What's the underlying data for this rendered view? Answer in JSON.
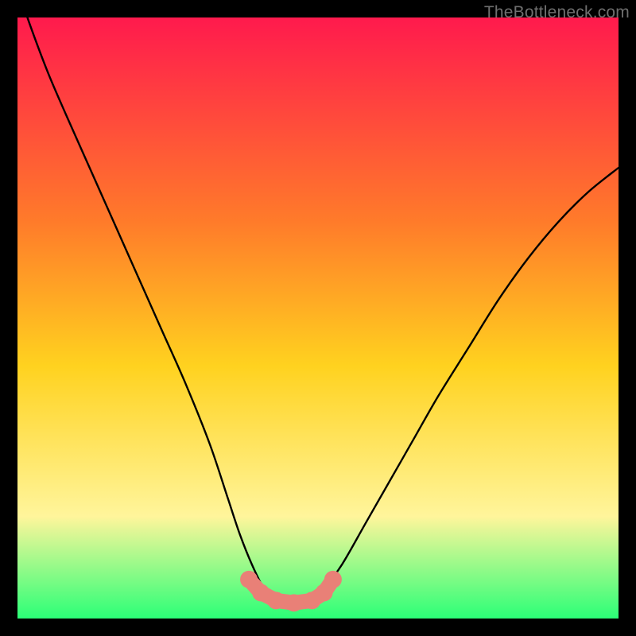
{
  "watermark": "TheBottleneck.com",
  "colors": {
    "bg": "#000000",
    "gradient_top": "#ff1a4d",
    "gradient_upper_mid": "#ff7b2a",
    "gradient_mid": "#ffd21f",
    "gradient_lower_mid": "#fff59b",
    "gradient_bottom": "#2bff77",
    "curve": "#000000",
    "marker_fill": "#e98077",
    "marker_stroke": "#c56159"
  },
  "chart_data": {
    "type": "line",
    "title": "",
    "xlabel": "",
    "ylabel": "",
    "xlim": [
      0,
      100
    ],
    "ylim": [
      0,
      100
    ],
    "x": [
      0,
      2,
      5,
      8,
      12,
      16,
      20,
      24,
      28,
      32,
      35,
      37,
      39,
      41,
      43,
      45,
      47,
      49,
      51,
      54,
      58,
      62,
      66,
      70,
      75,
      80,
      85,
      90,
      95,
      100
    ],
    "values": [
      105,
      99,
      91,
      84,
      75,
      66,
      57,
      48,
      39,
      29,
      20,
      14,
      9,
      5,
      3,
      2.5,
      2.5,
      3,
      5,
      9,
      16,
      23,
      30,
      37,
      45,
      53,
      60,
      66,
      71,
      75
    ],
    "markers": {
      "x": [
        38.5,
        40.5,
        43,
        46,
        49,
        51,
        52.5
      ],
      "y": [
        6.5,
        4.3,
        3.0,
        2.6,
        3.0,
        4.3,
        6.5
      ]
    }
  }
}
